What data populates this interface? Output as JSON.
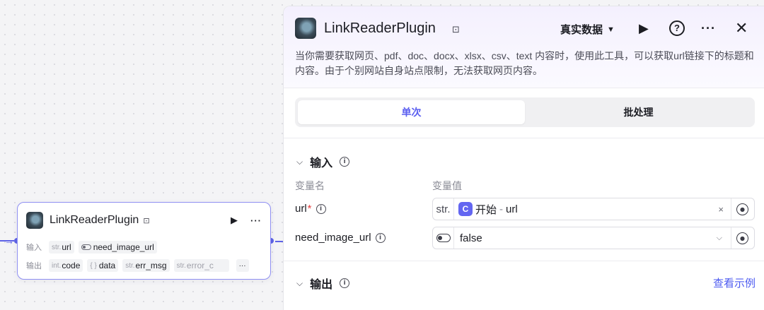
{
  "node": {
    "title": "LinkReaderPlugin",
    "input_label": "输入",
    "output_label": "输出",
    "inputs": [
      {
        "type": "str.",
        "name": "url"
      },
      {
        "type": "",
        "name": "need_image_url"
      }
    ],
    "outputs": [
      {
        "type": "int.",
        "name": "code"
      },
      {
        "type": "{ }",
        "name": "data"
      },
      {
        "type": "str.",
        "name": "err_msg"
      },
      {
        "type": "str.",
        "name": "error_c"
      }
    ],
    "more": "···"
  },
  "panel": {
    "title": "LinkReaderPlugin",
    "data_mode": "真实数据",
    "description": "当你需要获取网页、pdf、doc、docx、xlsx、csv、text 内容时，使用此工具，可以获取url链接下的标题和内容。由于个别网站自身站点限制，无法获取网页内容。",
    "tabs": [
      {
        "label": "单次",
        "active": true
      },
      {
        "label": "批处理",
        "active": false
      }
    ],
    "input_section": {
      "title": "输入",
      "col_name": "变量名",
      "col_value": "变量值",
      "params": [
        {
          "name": "url",
          "required": "*",
          "type_label": "str.",
          "ref_node": "开始",
          "ref_sep": "-",
          "ref_field": "url",
          "clear": "×"
        },
        {
          "name": "need_image_url",
          "value": "false"
        }
      ]
    },
    "output_section": {
      "title": "输出",
      "link": "查看示例"
    }
  },
  "colors": {
    "accent": "#5b5ff0",
    "node_border": "#8f8ff2",
    "link": "#4d5bf0",
    "required": "#e53e3e"
  }
}
